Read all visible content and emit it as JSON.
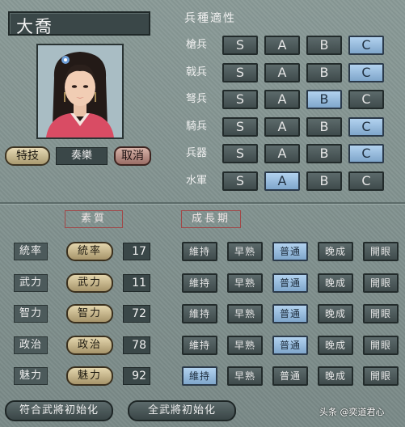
{
  "officer": {
    "name": "大喬",
    "skill_button": "特技",
    "skill_value": "奏樂",
    "cancel_button": "取消"
  },
  "aptitude": {
    "header": "兵種適性",
    "grades": [
      "S",
      "A",
      "B",
      "C"
    ],
    "rows": [
      {
        "label": "槍兵",
        "selected": "C"
      },
      {
        "label": "戟兵",
        "selected": "C"
      },
      {
        "label": "弩兵",
        "selected": "B"
      },
      {
        "label": "騎兵",
        "selected": "C"
      },
      {
        "label": "兵器",
        "selected": "C"
      },
      {
        "label": "水軍",
        "selected": "A"
      }
    ]
  },
  "sections": {
    "aptitude_label": "素質",
    "growth_label": "成長期"
  },
  "attributes": [
    {
      "name": "統率",
      "button": "統率",
      "value": "17",
      "growth": "普通"
    },
    {
      "name": "武力",
      "button": "武力",
      "value": "11",
      "growth": "普通"
    },
    {
      "name": "智力",
      "button": "智力",
      "value": "72",
      "growth": "普通"
    },
    {
      "name": "政治",
      "button": "政治",
      "value": "78",
      "growth": "普通"
    },
    {
      "name": "魅力",
      "button": "魅力",
      "value": "92",
      "growth": "維持"
    }
  ],
  "growth_options": [
    "維持",
    "早熟",
    "普通",
    "晚成",
    "開眼"
  ],
  "bottom": {
    "init_matching": "符合武將初始化",
    "init_all": "全武將初始化"
  },
  "watermark": "头条 @奕道君心",
  "colors": {
    "selected": "#9cc0e2",
    "panel": "#7c8c8a"
  }
}
